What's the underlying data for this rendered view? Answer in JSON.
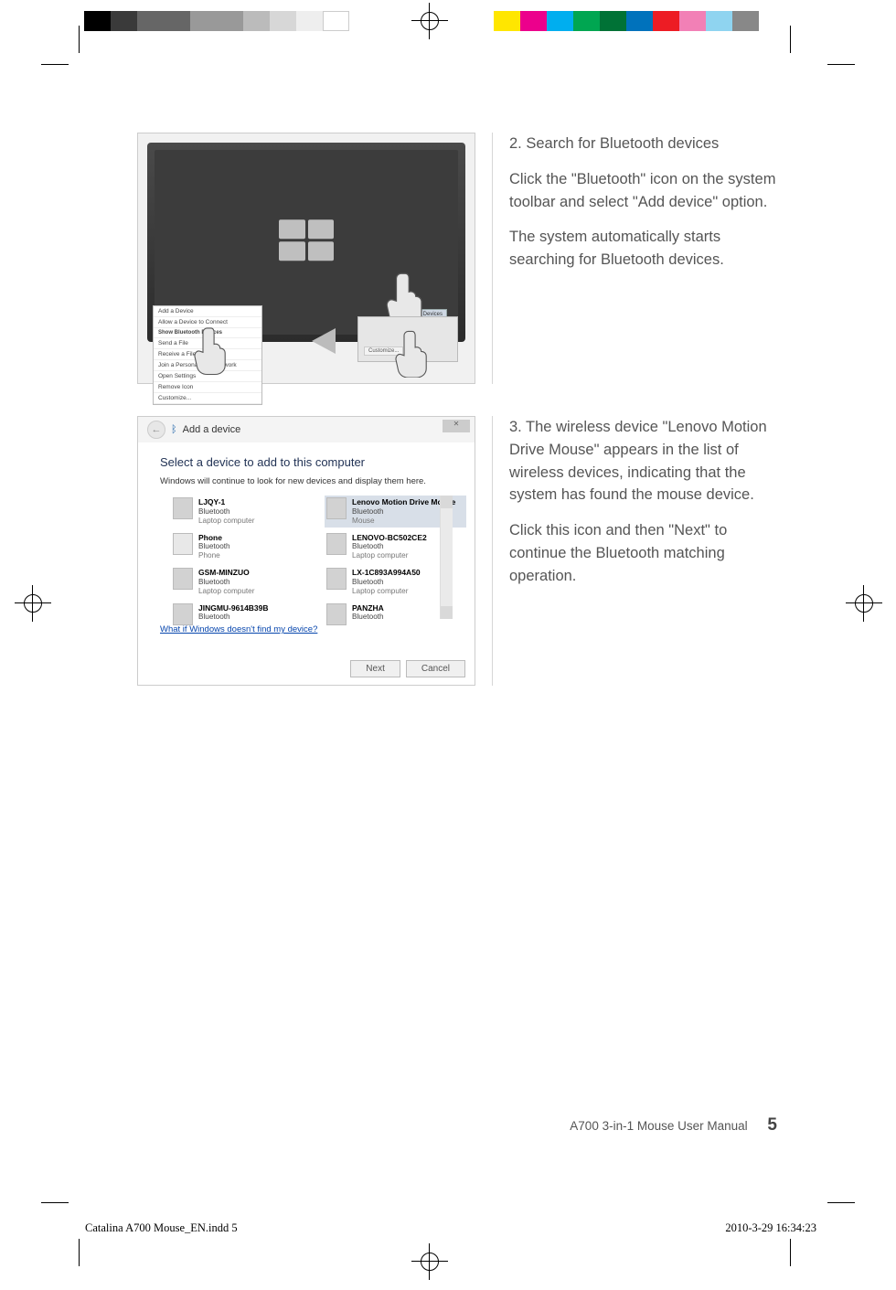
{
  "step2": {
    "title": "2. Search for Bluetooth devices",
    "p1": "Click the \"Bluetooth\" icon on the system toolbar and select \"Add device\" option.",
    "p2": "The system automatically starts searching for Bluetooth devices.",
    "tray_tooltip": "Bluetooth Devices",
    "context_menu": {
      "item1": "Add a Device",
      "item2": "Allow a Device to Connect",
      "item3": "Show Bluetooth Devices",
      "item4": "Send a File",
      "item5": "Receive a File",
      "item6": "Join a Personal Area Network",
      "item7": "Open Settings",
      "item8": "Remove Icon",
      "customize": "Customize..."
    },
    "tray_customize": "Customize..."
  },
  "step3": {
    "p1": "3. The wireless device \"Lenovo Motion Drive Mouse\" appears in the list of wireless devices, indicating that the system has found the mouse device.",
    "p2": "Click this icon and then \"Next\" to continue the Bluetooth matching operation.",
    "dialog": {
      "title": "Add a device",
      "heading": "Select a device to add to this computer",
      "sub": "Windows will continue to look for new devices and display them here.",
      "devices_left": [
        {
          "name": "LJQY-1",
          "l1": "Bluetooth",
          "l2": "Laptop computer"
        },
        {
          "name": "Phone",
          "l1": "Bluetooth",
          "l2": "Phone"
        },
        {
          "name": "GSM-MINZUO",
          "l1": "Bluetooth",
          "l2": "Laptop computer"
        },
        {
          "name": "JINGMU-9614B39B",
          "l1": "Bluetooth",
          "l2": ""
        }
      ],
      "devices_right": [
        {
          "name": "Lenovo Motion Drive Mouse",
          "l1": "Bluetooth",
          "l2": "Mouse",
          "selected": true
        },
        {
          "name": "LENOVO-BC502CE2",
          "l1": "Bluetooth",
          "l2": "Laptop computer"
        },
        {
          "name": "LX-1C893A994A50",
          "l1": "Bluetooth",
          "l2": "Laptop computer"
        },
        {
          "name": "PANZHA",
          "l1": "Bluetooth",
          "l2": ""
        }
      ],
      "help_link": "What if Windows doesn't find my device?",
      "btn_next": "Next",
      "btn_cancel": "Cancel"
    }
  },
  "footer": {
    "manual_title": "A700 3-in-1 Mouse User Manual",
    "page_number": "5",
    "indd_file": "Catalina A700 Mouse_EN.indd   5",
    "indd_time": "2010-3-29   16:34:23"
  }
}
